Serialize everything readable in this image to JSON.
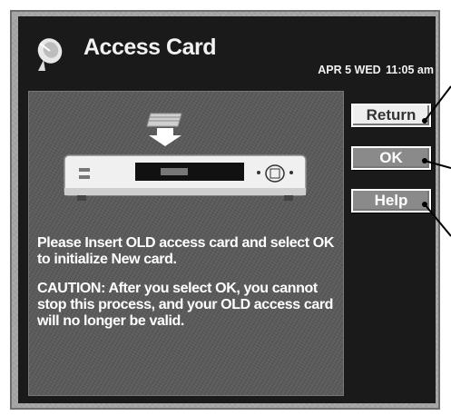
{
  "header": {
    "title": "Access Card",
    "date": "APR 5 WED",
    "time": "11:05 am",
    "icon": "satellite-dish-icon"
  },
  "message": {
    "instruction": "Please Insert OLD access card and select OK to initialize New card.",
    "caution": "CAUTION: After you select OK, you cannot stop this process, and your OLD access card will no longer be valid."
  },
  "buttons": {
    "return_label": "Return",
    "ok_label": "OK",
    "help_label": "Help"
  },
  "colors": {
    "screen_bg": "#1a1a1a",
    "panel_bg": "#5b5b5b",
    "frame_bg": "#a9a9a9",
    "selected_button": "#eeeeee",
    "button": "#8a8a8a"
  }
}
